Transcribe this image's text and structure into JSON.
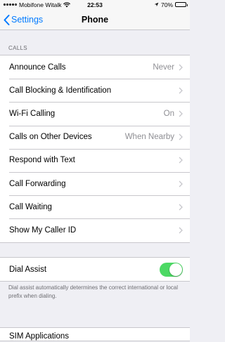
{
  "status": {
    "carrier": "Mobifone Witalk",
    "time": "22:53",
    "battery": "70%",
    "battery_level": 0.7
  },
  "nav": {
    "back_label": "Settings",
    "title": "Phone"
  },
  "calls_section": {
    "header": "CALLS",
    "rows": [
      {
        "label": "Announce Calls",
        "value": "Never"
      },
      {
        "label": "Call Blocking & Identification",
        "value": ""
      },
      {
        "label": "Wi-Fi Calling",
        "value": "On"
      },
      {
        "label": "Calls on Other Devices",
        "value": "When Nearby"
      },
      {
        "label": "Respond with Text",
        "value": ""
      },
      {
        "label": "Call Forwarding",
        "value": ""
      },
      {
        "label": "Call Waiting",
        "value": ""
      },
      {
        "label": "Show My Caller ID",
        "value": ""
      }
    ]
  },
  "dial_assist": {
    "label": "Dial Assist",
    "enabled": true,
    "toggle_color": "#4cd964",
    "footer": "Dial assist automatically determines the correct international or local prefix when dialing."
  },
  "sim": {
    "label": "SIM Applications"
  },
  "colors": {
    "accent": "#007aff",
    "background": "#efeff4"
  }
}
